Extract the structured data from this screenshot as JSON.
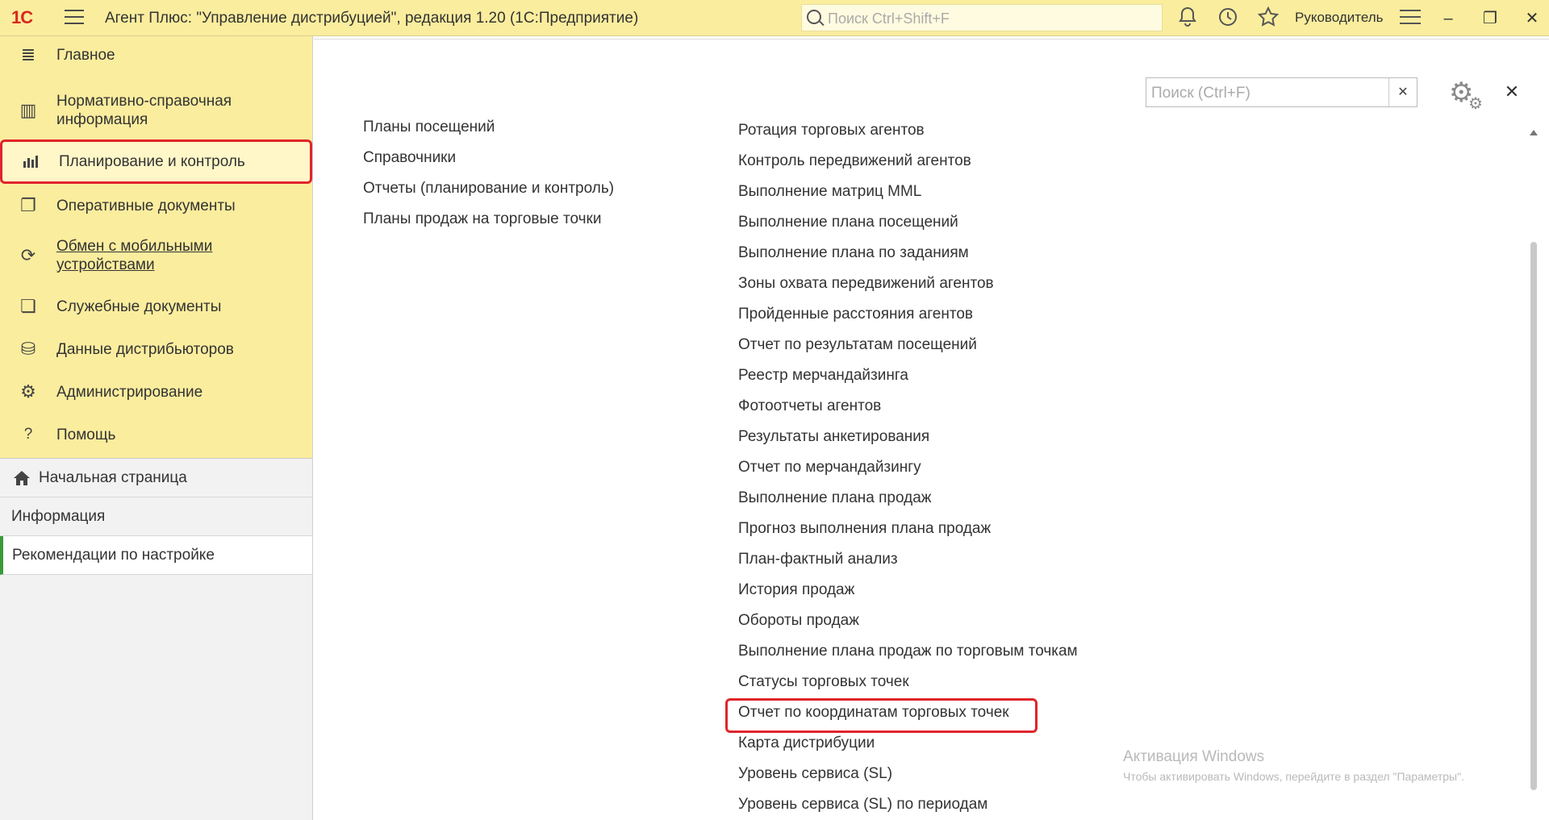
{
  "titlebar": {
    "logo": "1С",
    "title": "Агент Плюс: \"Управление дистрибуцией\", редакция 1.20  (1С:Предприятие)",
    "search_placeholder": "Поиск Ctrl+Shift+F",
    "user": "Руководитель",
    "icons": [
      "bell-icon",
      "history-icon",
      "star-icon"
    ]
  },
  "sidebar": {
    "sections": [
      {
        "label": "Главное",
        "icon": "list-icon"
      },
      {
        "label": "Нормативно-справочная информация",
        "icon": "columns-icon"
      },
      {
        "label": "Планирование и контроль",
        "icon": "chart-icon"
      },
      {
        "label": "Оперативные документы",
        "icon": "documents-icon"
      },
      {
        "label": "Обмен с мобильными устройствами",
        "icon": "sync-icon"
      },
      {
        "label": "Служебные документы",
        "icon": "service-docs-icon"
      },
      {
        "label": "Данные дистрибьюторов",
        "icon": "distributors-icon"
      },
      {
        "label": "Администрирование",
        "icon": "gear-icon"
      },
      {
        "label": "Помощь",
        "icon": "help-icon"
      }
    ],
    "pages": [
      {
        "label": "Начальная страница"
      },
      {
        "label": "Информация"
      },
      {
        "label": "Рекомендации по настройке"
      }
    ]
  },
  "panel": {
    "search_placeholder": "Поиск (Ctrl+F)",
    "left_column": [
      "Планы посещений",
      "Справочники",
      "Отчеты (планирование и контроль)",
      "Планы продаж на торговые точки"
    ],
    "right_column": [
      "Ротация торговых агентов",
      "Контроль передвижений агентов",
      "Выполнение матриц MML",
      "Выполнение плана посещений",
      "Выполнение плана по заданиям",
      "Зоны охвата передвижений агентов",
      "Пройденные расстояния агентов",
      "Отчет по результатам посещений",
      "Реестр мерчандайзинга",
      "Фотоотчеты агентов",
      "Результаты анкетирования",
      "Отчет по  мерчандайзингу",
      "Выполнение плана продаж",
      "Прогноз выполнения плана продаж",
      "План-фактный анализ",
      "История продаж",
      "Обороты продаж",
      "Выполнение плана продаж по торговым точкам",
      "Статусы торговых точек",
      "Отчет по координатам торговых точек",
      "Карта дистрибуции",
      "Уровень сервиса (SL)",
      "Уровень сервиса (SL) по периодам"
    ]
  },
  "watermark": {
    "line1": "Активация Windows",
    "line2": "Чтобы активировать Windows, перейдите в раздел \"Параметры\"."
  }
}
